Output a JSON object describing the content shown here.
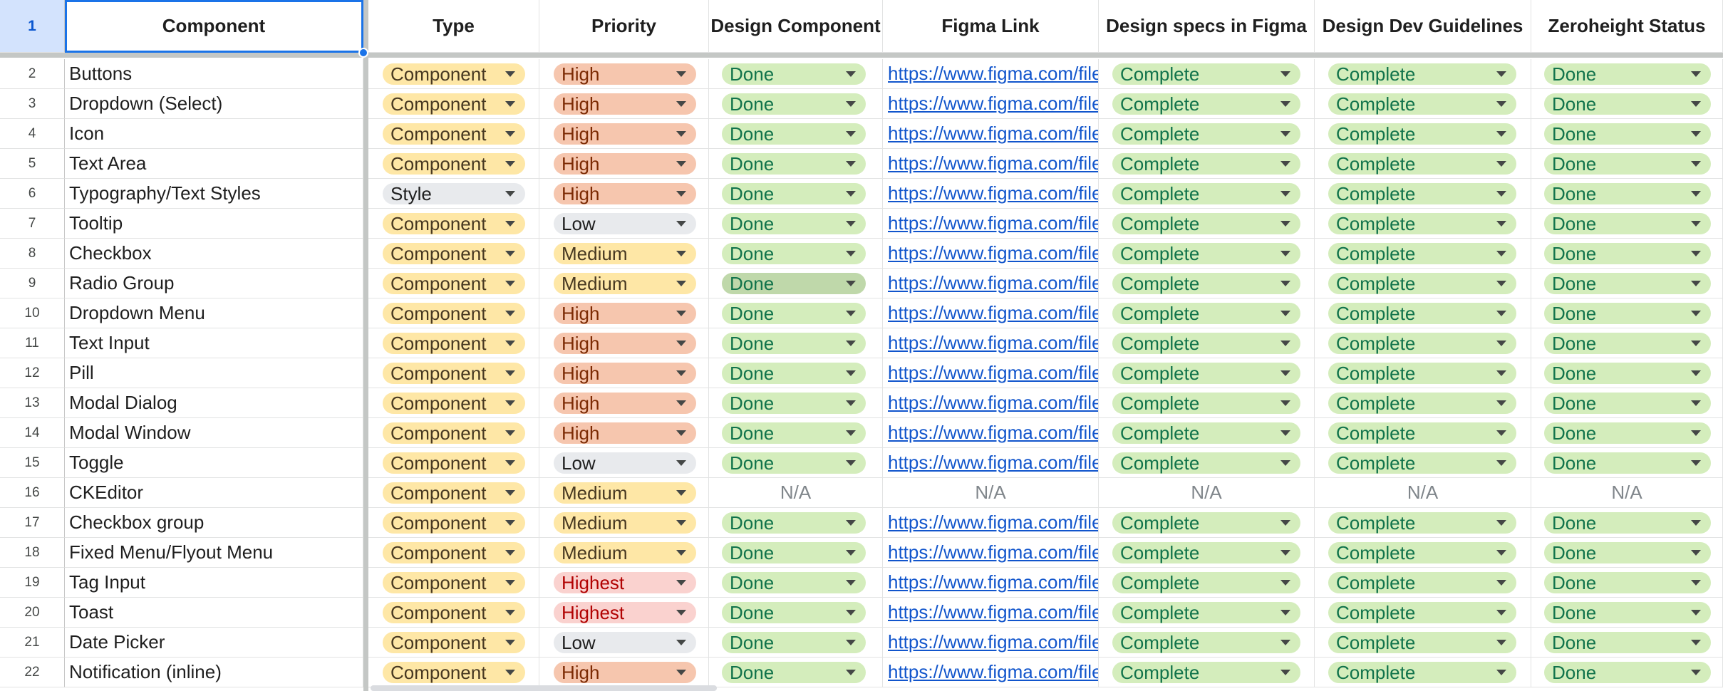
{
  "header": {
    "row_number": "1",
    "columns": [
      "Component",
      "Type",
      "Priority",
      "Design Component",
      "Figma Link",
      "Design specs in Figma",
      "Design Dev Guidelines",
      "Zeroheight Status"
    ]
  },
  "colors": {
    "type_component": "#fee7a6",
    "type_style": "#e8eaed",
    "priority_high": "#f6c6ae",
    "priority_medium": "#fee7a6",
    "priority_low": "#e8eaed",
    "priority_highest": "#fad2cf",
    "done": "#d4edbc",
    "done_selected": "#bfd8aa",
    "complete": "#d4edbc",
    "text_component": "#473821",
    "text_high": "#7c2a03",
    "text_medium": "#473821",
    "text_low": "#1f1f1f",
    "text_highest": "#b10202",
    "text_done": "#11734b",
    "link": "#1155cc",
    "na_text": "#80868b",
    "selection": "#1a73e8"
  },
  "na_label": "N/A",
  "link_text": "https://www.figma.com/file/",
  "rows": [
    {
      "n": "2",
      "component": "Buttons",
      "type": "Component",
      "priority": "High",
      "design": "Done",
      "link": true,
      "specs": "Complete",
      "guidelines": "Complete",
      "zeroheight": "Done"
    },
    {
      "n": "3",
      "component": "Dropdown (Select)",
      "type": "Component",
      "priority": "High",
      "design": "Done",
      "link": true,
      "specs": "Complete",
      "guidelines": "Complete",
      "zeroheight": "Done"
    },
    {
      "n": "4",
      "component": "Icon",
      "type": "Component",
      "priority": "High",
      "design": "Done",
      "link": true,
      "specs": "Complete",
      "guidelines": "Complete",
      "zeroheight": "Done"
    },
    {
      "n": "5",
      "component": "Text Area",
      "type": "Component",
      "priority": "High",
      "design": "Done",
      "link": true,
      "specs": "Complete",
      "guidelines": "Complete",
      "zeroheight": "Done"
    },
    {
      "n": "6",
      "component": "Typography/Text Styles",
      "type": "Style",
      "priority": "High",
      "design": "Done",
      "link": true,
      "specs": "Complete",
      "guidelines": "Complete",
      "zeroheight": "Done"
    },
    {
      "n": "7",
      "component": "Tooltip",
      "type": "Component",
      "priority": "Low",
      "design": "Done",
      "link": true,
      "specs": "Complete",
      "guidelines": "Complete",
      "zeroheight": "Done"
    },
    {
      "n": "8",
      "component": "Checkbox",
      "type": "Component",
      "priority": "Medium",
      "design": "Done",
      "link": true,
      "specs": "Complete",
      "guidelines": "Complete",
      "zeroheight": "Done"
    },
    {
      "n": "9",
      "component": "Radio Group",
      "type": "Component",
      "priority": "Medium",
      "design": "Done",
      "design_hover": true,
      "link": true,
      "specs": "Complete",
      "guidelines": "Complete",
      "zeroheight": "Done"
    },
    {
      "n": "10",
      "component": "Dropdown Menu",
      "type": "Component",
      "priority": "High",
      "design": "Done",
      "link": true,
      "specs": "Complete",
      "guidelines": "Complete",
      "zeroheight": "Done"
    },
    {
      "n": "11",
      "component": "Text Input",
      "type": "Component",
      "priority": "High",
      "design": "Done",
      "link": true,
      "specs": "Complete",
      "guidelines": "Complete",
      "zeroheight": "Done"
    },
    {
      "n": "12",
      "component": "Pill",
      "type": "Component",
      "priority": "High",
      "design": "Done",
      "link": true,
      "specs": "Complete",
      "guidelines": "Complete",
      "zeroheight": "Done"
    },
    {
      "n": "13",
      "component": "Modal Dialog",
      "type": "Component",
      "priority": "High",
      "design": "Done",
      "link": true,
      "specs": "Complete",
      "guidelines": "Complete",
      "zeroheight": "Done"
    },
    {
      "n": "14",
      "component": "Modal Window",
      "type": "Component",
      "priority": "High",
      "design": "Done",
      "link": true,
      "specs": "Complete",
      "guidelines": "Complete",
      "zeroheight": "Done"
    },
    {
      "n": "15",
      "component": "Toggle",
      "type": "Component",
      "priority": "Low",
      "design": "Done",
      "link": true,
      "specs": "Complete",
      "guidelines": "Complete",
      "zeroheight": "Done"
    },
    {
      "n": "16",
      "component": "CKEditor",
      "type": "Component",
      "priority": "Medium",
      "design": "N/A",
      "link": false,
      "specs": "N/A",
      "guidelines": "N/A",
      "zeroheight": "N/A"
    },
    {
      "n": "17",
      "component": "Checkbox group",
      "type": "Component",
      "priority": "Medium",
      "design": "Done",
      "link": true,
      "specs": "Complete",
      "guidelines": "Complete",
      "zeroheight": "Done"
    },
    {
      "n": "18",
      "component": "Fixed Menu/Flyout Menu",
      "type": "Component",
      "priority": "Medium",
      "design": "Done",
      "link": true,
      "specs": "Complete",
      "guidelines": "Complete",
      "zeroheight": "Done"
    },
    {
      "n": "19",
      "component": "Tag Input",
      "type": "Component",
      "priority": "Highest",
      "design": "Done",
      "link": true,
      "specs": "Complete",
      "guidelines": "Complete",
      "zeroheight": "Done"
    },
    {
      "n": "20",
      "component": "Toast",
      "type": "Component",
      "priority": "Highest",
      "design": "Done",
      "link": true,
      "specs": "Complete",
      "guidelines": "Complete",
      "zeroheight": "Done"
    },
    {
      "n": "21",
      "component": "Date Picker",
      "type": "Component",
      "priority": "Low",
      "design": "Done",
      "link": true,
      "specs": "Complete",
      "guidelines": "Complete",
      "zeroheight": "Done"
    },
    {
      "n": "22",
      "component": "Notification (inline)",
      "type": "Component",
      "priority": "High",
      "design": "Done",
      "link": true,
      "specs": "Complete",
      "guidelines": "Complete",
      "zeroheight": "Done"
    }
  ]
}
